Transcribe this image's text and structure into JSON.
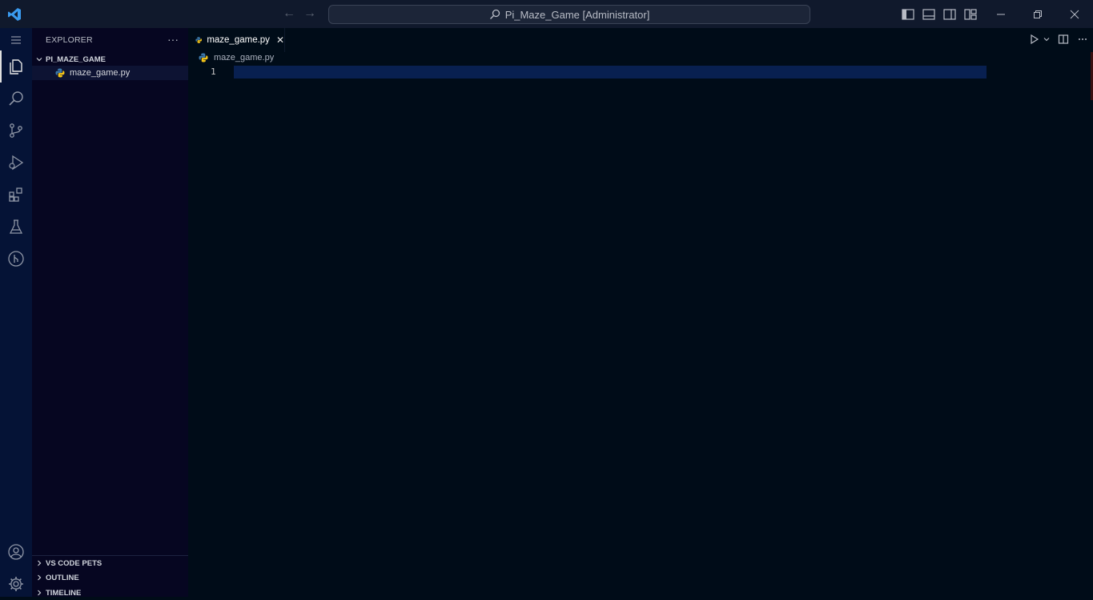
{
  "titlebar": {
    "command_center_text": "Pi_Maze_Game [Administrator]",
    "nav_back_icon": "arrow-left-icon",
    "nav_forward_icon": "arrow-right-icon"
  },
  "activity_bar": {
    "items": [
      {
        "name": "menu-icon"
      },
      {
        "name": "explorer-icon"
      },
      {
        "name": "search-icon"
      },
      {
        "name": "source-control-icon"
      },
      {
        "name": "run-debug-icon"
      },
      {
        "name": "extensions-icon"
      },
      {
        "name": "testing-icon"
      },
      {
        "name": "git-graph-icon"
      },
      {
        "name": "account-icon"
      },
      {
        "name": "settings-gear-icon"
      }
    ]
  },
  "sidebar": {
    "title": "EXPLORER",
    "more_label": "···",
    "folder_name": "PI_MAZE_GAME",
    "files": [
      {
        "name": "maze_game.py"
      }
    ],
    "sections": [
      "VS CODE PETS",
      "OUTLINE",
      "TIMELINE"
    ]
  },
  "editor": {
    "tab_label": "maze_game.py",
    "close_label": "✕",
    "breadcrumb_file": "maze_game.py",
    "line_numbers": [
      "1"
    ]
  },
  "colors": {
    "accent_line_highlight": "#082050",
    "python_icon_blue": "#3c78aa",
    "python_icon_yellow": "#f5c518"
  }
}
